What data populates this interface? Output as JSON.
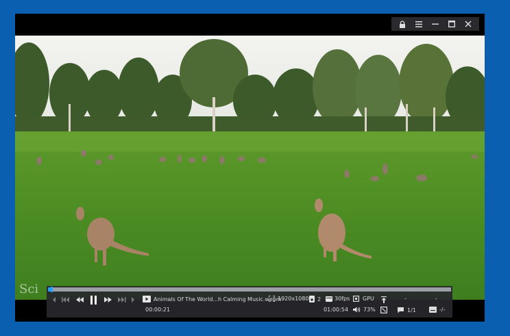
{
  "player": {
    "file_name": "Animals Of The World...h Calming Music.webm",
    "resolution": "1920x1080",
    "audio_tracks": "2",
    "fps": "30fps",
    "decoder": "GPU",
    "current_time": "00:00:21",
    "duration": "01:00:54",
    "volume": "73%",
    "subtitle_count": "1/1",
    "subtitle_timing": "-/-",
    "dash1": "-",
    "dash2": "-",
    "progress": 0.006
  },
  "watermark": "Sci",
  "icons": {
    "lock": "lock-icon",
    "menu": "menu-icon",
    "minimize": "minimize-icon",
    "maximize": "maximize-icon",
    "close": "close-icon"
  },
  "colors": {
    "accent": "#2a9df4",
    "desktop": "#0a5fb0"
  }
}
